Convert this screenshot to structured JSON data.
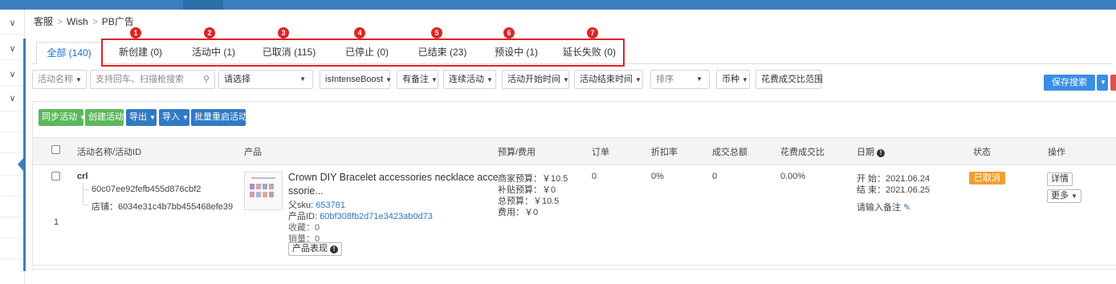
{
  "breadcrumb": [
    "客服",
    "Wish",
    "PB广告"
  ],
  "tabs": [
    {
      "label": "全部 (140)",
      "active": true
    },
    {
      "label": "新创建 (0)"
    },
    {
      "label": "活动中 (1)"
    },
    {
      "label": "已取消 (115)"
    },
    {
      "label": "已停止 (0)"
    },
    {
      "label": "已结束 (23)"
    },
    {
      "label": "预设中 (1)"
    },
    {
      "label": "延长失败 (0)"
    }
  ],
  "tab_numbers": [
    "1",
    "2",
    "3",
    "4",
    "5",
    "6",
    "7"
  ],
  "filters": {
    "campaign_name": "活动名称",
    "search_placeholder": "支持回车、扫描枪搜索",
    "select": "请选择",
    "intense_boost": "isIntenseBoost",
    "has_note": "有备注",
    "continuous": "连续活动",
    "start_time": "活动开始时间",
    "end_time": "活动结束时间",
    "sort": "排序",
    "currency": "币种",
    "ratio_range": "花费成交比范围",
    "save_search": "保存搜索"
  },
  "actions": {
    "sync": "同步活动",
    "create": "创建活动",
    "export": "导出",
    "import": "导入",
    "batch_restart": "批量重启活动"
  },
  "columns": [
    "活动名称/活动ID",
    "产品",
    "预算/费用",
    "订单",
    "折扣率",
    "成交总额",
    "花费成交比",
    "日期",
    "状态",
    "操作"
  ],
  "row": {
    "index": "1",
    "name": "crl",
    "campaign_id": "60c07ee92fefb455d876cbf2",
    "store": "店铺：6034e31c4b7bb455468efe39",
    "product_title_1": "Crown DIY Bracelet accessories necklace acce",
    "product_title_2": "ssorie...",
    "parent_sku_label": "父sku: ",
    "parent_sku": "653781",
    "product_id_label": "产品ID: ",
    "product_id": "60bf308fb2d71e3423ab0d73",
    "favorites": "收藏：0",
    "sales": "销量：0",
    "perf_button": "产品表现",
    "budget_merchant": "商家预算：￥10.5",
    "budget_subsidy": "补贴预算：￥0",
    "budget_total": "总预算：￥10.5",
    "cost": "费用：￥0",
    "orders": "0",
    "discount": "0%",
    "gmv": "0",
    "ratio": "0.00%",
    "start": "开 始：2021.06.24",
    "end": "结 束：2021.06.25",
    "note": "请输入备注",
    "status": "已取消",
    "details": "详情",
    "more": "更多"
  },
  "colors": {
    "accent": "#3a7fc0",
    "highlight": "#e02424",
    "status_cancelled": "#f0a030",
    "green": "#5cb85c"
  }
}
